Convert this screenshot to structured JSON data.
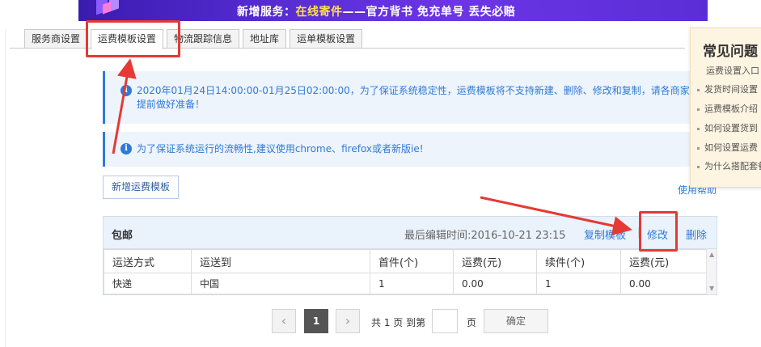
{
  "banner": {
    "prefix": "新增服务：",
    "highlight": "在线寄件",
    "suffix": "——官方背书 免充单号 丢失必赔"
  },
  "tabs": [
    {
      "label": "服务商设置",
      "active": false
    },
    {
      "label": "运费模板设置",
      "active": true
    },
    {
      "label": "物流跟踪信息",
      "active": false
    },
    {
      "label": "地址库",
      "active": false
    },
    {
      "label": "运单模板设置",
      "active": false
    }
  ],
  "notices": {
    "maintenance": "2020年01月24日14:00:00-01月25日02:00:00，为了保证系统稳定性，运费模板将不支持新建、删除、修改和复制，请各商家提前做好准备！",
    "browser": "为了保证系统运行的流畅性,建议使用chrome、firefox或者新版ie!"
  },
  "actions": {
    "new_template": "新增运费模板",
    "help": "使用帮助"
  },
  "template": {
    "name": "包邮",
    "edited_at": "最后编辑时间:2016-10-21 23:15",
    "copy": "复制模板",
    "separator": "|",
    "edit": "修改",
    "delete": "删除",
    "columns": [
      "运送方式",
      "运送到",
      "首件(个)",
      "运费(元)",
      "续件(个)",
      "运费(元)"
    ],
    "rows": [
      [
        "快递",
        "中国",
        "1",
        "0.00",
        "1",
        "0.00"
      ]
    ]
  },
  "pagination": {
    "prev": "‹",
    "current": "1",
    "next": "›",
    "total": "共 1 页 到第",
    "unit": "页",
    "confirm": "确定"
  },
  "faq": {
    "title": "常见问题",
    "subtitle": "运费设置入口",
    "items": [
      "发货时间设置",
      "运费模板介绍",
      "如何设置货到",
      "如何设置运费",
      "为什么搭配套餐前设置的模板"
    ]
  },
  "colors": {
    "accent": "#2f7ad8",
    "annotation": "#e53935",
    "notice_bg": "#eef4fb"
  }
}
